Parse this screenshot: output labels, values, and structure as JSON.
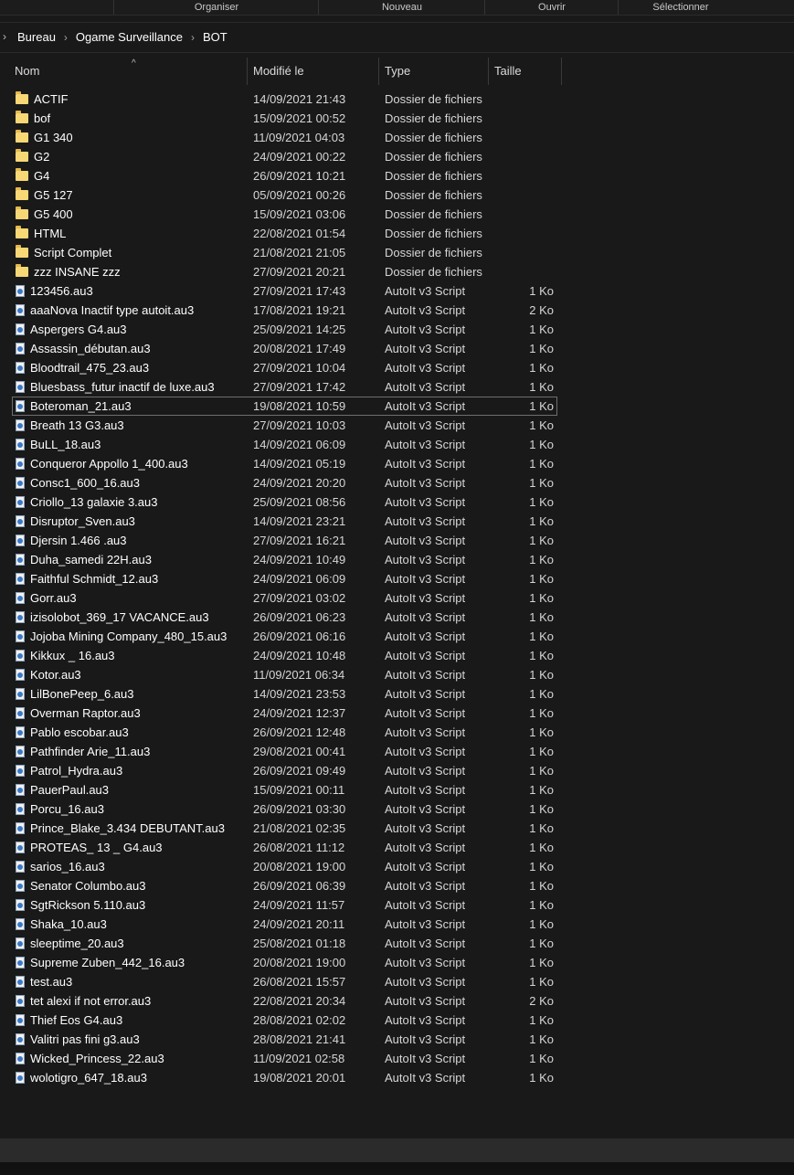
{
  "ribbon": {
    "groups": [
      "Organiser",
      "Nouveau",
      "Ouvrir",
      "Sélectionner"
    ]
  },
  "address": {
    "lead": "›",
    "crumbs": [
      "Bureau",
      "Ogame Surveillance",
      "BOT"
    ],
    "separator": "›"
  },
  "columns": {
    "name": "Nom",
    "modified": "Modifié le",
    "type": "Type",
    "size": "Taille",
    "sort_arrow": "^"
  },
  "icons": {
    "folder": "folder-icon",
    "file": "autoit-script-icon"
  },
  "focused_index": 16,
  "files": [
    {
      "kind": "folder",
      "name": "ACTIF",
      "date": "14/09/2021 21:43",
      "type": "Dossier de fichiers",
      "size": ""
    },
    {
      "kind": "folder",
      "name": "bof",
      "date": "15/09/2021 00:52",
      "type": "Dossier de fichiers",
      "size": ""
    },
    {
      "kind": "folder",
      "name": "G1 340",
      "date": "11/09/2021 04:03",
      "type": "Dossier de fichiers",
      "size": ""
    },
    {
      "kind": "folder",
      "name": "G2",
      "date": "24/09/2021 00:22",
      "type": "Dossier de fichiers",
      "size": ""
    },
    {
      "kind": "folder",
      "name": "G4",
      "date": "26/09/2021 10:21",
      "type": "Dossier de fichiers",
      "size": ""
    },
    {
      "kind": "folder",
      "name": "G5 127",
      "date": "05/09/2021 00:26",
      "type": "Dossier de fichiers",
      "size": ""
    },
    {
      "kind": "folder",
      "name": "G5 400",
      "date": "15/09/2021 03:06",
      "type": "Dossier de fichiers",
      "size": ""
    },
    {
      "kind": "folder",
      "name": "HTML",
      "date": "22/08/2021 01:54",
      "type": "Dossier de fichiers",
      "size": ""
    },
    {
      "kind": "folder",
      "name": "Script Complet",
      "date": "21/08/2021 21:05",
      "type": "Dossier de fichiers",
      "size": ""
    },
    {
      "kind": "folder",
      "name": "zzz INSANE zzz",
      "date": "27/09/2021 20:21",
      "type": "Dossier de fichiers",
      "size": ""
    },
    {
      "kind": "file",
      "name": "123456.au3",
      "date": "27/09/2021 17:43",
      "type": "AutoIt v3 Script",
      "size": "1 Ko"
    },
    {
      "kind": "file",
      "name": "aaaNova Inactif type autoit.au3",
      "date": "17/08/2021 19:21",
      "type": "AutoIt v3 Script",
      "size": "2 Ko"
    },
    {
      "kind": "file",
      "name": "Aspergers G4.au3",
      "date": "25/09/2021 14:25",
      "type": "AutoIt v3 Script",
      "size": "1 Ko"
    },
    {
      "kind": "file",
      "name": "Assassin_débutan.au3",
      "date": "20/08/2021 17:49",
      "type": "AutoIt v3 Script",
      "size": "1 Ko"
    },
    {
      "kind": "file",
      "name": "Bloodtrail_475_23.au3",
      "date": "27/09/2021 10:04",
      "type": "AutoIt v3 Script",
      "size": "1 Ko"
    },
    {
      "kind": "file",
      "name": "Bluesbass_futur inactif de luxe.au3",
      "date": "27/09/2021 17:42",
      "type": "AutoIt v3 Script",
      "size": "1 Ko"
    },
    {
      "kind": "file",
      "name": "Boteroman_21.au3",
      "date": "19/08/2021 10:59",
      "type": "AutoIt v3 Script",
      "size": "1 Ko"
    },
    {
      "kind": "file",
      "name": "Breath 13 G3.au3",
      "date": "27/09/2021 10:03",
      "type": "AutoIt v3 Script",
      "size": "1 Ko"
    },
    {
      "kind": "file",
      "name": "BuLL_18.au3",
      "date": "14/09/2021 06:09",
      "type": "AutoIt v3 Script",
      "size": "1 Ko"
    },
    {
      "kind": "file",
      "name": "Conqueror Appollo 1_400.au3",
      "date": "14/09/2021 05:19",
      "type": "AutoIt v3 Script",
      "size": "1 Ko"
    },
    {
      "kind": "file",
      "name": "Consc1_600_16.au3",
      "date": "24/09/2021 20:20",
      "type": "AutoIt v3 Script",
      "size": "1 Ko"
    },
    {
      "kind": "file",
      "name": "Criollo_13 galaxie 3.au3",
      "date": "25/09/2021 08:56",
      "type": "AutoIt v3 Script",
      "size": "1 Ko"
    },
    {
      "kind": "file",
      "name": "Disruptor_Sven.au3",
      "date": "14/09/2021 23:21",
      "type": "AutoIt v3 Script",
      "size": "1 Ko"
    },
    {
      "kind": "file",
      "name": "Djersin 1.466 .au3",
      "date": "27/09/2021 16:21",
      "type": "AutoIt v3 Script",
      "size": "1 Ko"
    },
    {
      "kind": "file",
      "name": "Duha_samedi 22H.au3",
      "date": "24/09/2021 10:49",
      "type": "AutoIt v3 Script",
      "size": "1 Ko"
    },
    {
      "kind": "file",
      "name": "Faithful Schmidt_12.au3",
      "date": "24/09/2021 06:09",
      "type": "AutoIt v3 Script",
      "size": "1 Ko"
    },
    {
      "kind": "file",
      "name": "Gorr.au3",
      "date": "27/09/2021 03:02",
      "type": "AutoIt v3 Script",
      "size": "1 Ko"
    },
    {
      "kind": "file",
      "name": "izisolobot_369_17 VACANCE.au3",
      "date": "26/09/2021 06:23",
      "type": "AutoIt v3 Script",
      "size": "1 Ko"
    },
    {
      "kind": "file",
      "name": "Jojoba Mining Company_480_15.au3",
      "date": "26/09/2021 06:16",
      "type": "AutoIt v3 Script",
      "size": "1 Ko"
    },
    {
      "kind": "file",
      "name": "Kikkux _ 16.au3",
      "date": "24/09/2021 10:48",
      "type": "AutoIt v3 Script",
      "size": "1 Ko"
    },
    {
      "kind": "file",
      "name": "Kotor.au3",
      "date": "11/09/2021 06:34",
      "type": "AutoIt v3 Script",
      "size": "1 Ko"
    },
    {
      "kind": "file",
      "name": "LilBonePeep_6.au3",
      "date": "14/09/2021 23:53",
      "type": "AutoIt v3 Script",
      "size": "1 Ko"
    },
    {
      "kind": "file",
      "name": "Overman Raptor.au3",
      "date": "24/09/2021 12:37",
      "type": "AutoIt v3 Script",
      "size": "1 Ko"
    },
    {
      "kind": "file",
      "name": "Pablo escobar.au3",
      "date": "26/09/2021 12:48",
      "type": "AutoIt v3 Script",
      "size": "1 Ko"
    },
    {
      "kind": "file",
      "name": "Pathfinder Arie_11.au3",
      "date": "29/08/2021 00:41",
      "type": "AutoIt v3 Script",
      "size": "1 Ko"
    },
    {
      "kind": "file",
      "name": "Patrol_Hydra.au3",
      "date": "26/09/2021 09:49",
      "type": "AutoIt v3 Script",
      "size": "1 Ko"
    },
    {
      "kind": "file",
      "name": "PauerPaul.au3",
      "date": "15/09/2021 00:11",
      "type": "AutoIt v3 Script",
      "size": "1 Ko"
    },
    {
      "kind": "file",
      "name": "Porcu_16.au3",
      "date": "26/09/2021 03:30",
      "type": "AutoIt v3 Script",
      "size": "1 Ko"
    },
    {
      "kind": "file",
      "name": "Prince_Blake_3.434 DEBUTANT.au3",
      "date": "21/08/2021 02:35",
      "type": "AutoIt v3 Script",
      "size": "1 Ko"
    },
    {
      "kind": "file",
      "name": "PROTEAS_ 13 _ G4.au3",
      "date": "26/08/2021 11:12",
      "type": "AutoIt v3 Script",
      "size": "1 Ko"
    },
    {
      "kind": "file",
      "name": "sarios_16.au3",
      "date": "20/08/2021 19:00",
      "type": "AutoIt v3 Script",
      "size": "1 Ko"
    },
    {
      "kind": "file",
      "name": "Senator Columbo.au3",
      "date": "26/09/2021 06:39",
      "type": "AutoIt v3 Script",
      "size": "1 Ko"
    },
    {
      "kind": "file",
      "name": "SgtRickson 5.110.au3",
      "date": "24/09/2021 11:57",
      "type": "AutoIt v3 Script",
      "size": "1 Ko"
    },
    {
      "kind": "file",
      "name": "Shaka_10.au3",
      "date": "24/09/2021 20:11",
      "type": "AutoIt v3 Script",
      "size": "1 Ko"
    },
    {
      "kind": "file",
      "name": "sleeptime_20.au3",
      "date": "25/08/2021 01:18",
      "type": "AutoIt v3 Script",
      "size": "1 Ko"
    },
    {
      "kind": "file",
      "name": "Supreme Zuben_442_16.au3",
      "date": "20/08/2021 19:00",
      "type": "AutoIt v3 Script",
      "size": "1 Ko"
    },
    {
      "kind": "file",
      "name": "test.au3",
      "date": "26/08/2021 15:57",
      "type": "AutoIt v3 Script",
      "size": "1 Ko"
    },
    {
      "kind": "file",
      "name": "tet alexi if not error.au3",
      "date": "22/08/2021 20:34",
      "type": "AutoIt v3 Script",
      "size": "2 Ko"
    },
    {
      "kind": "file",
      "name": "Thief Eos G4.au3",
      "date": "28/08/2021 02:02",
      "type": "AutoIt v3 Script",
      "size": "1 Ko"
    },
    {
      "kind": "file",
      "name": "Valitri pas fini g3.au3",
      "date": "28/08/2021 21:41",
      "type": "AutoIt v3 Script",
      "size": "1 Ko"
    },
    {
      "kind": "file",
      "name": "Wicked_Princess_22.au3",
      "date": "11/09/2021 02:58",
      "type": "AutoIt v3 Script",
      "size": "1 Ko"
    },
    {
      "kind": "file",
      "name": "wolotigro_647_18.au3",
      "date": "19/08/2021 20:01",
      "type": "AutoIt v3 Script",
      "size": "1 Ko"
    }
  ]
}
